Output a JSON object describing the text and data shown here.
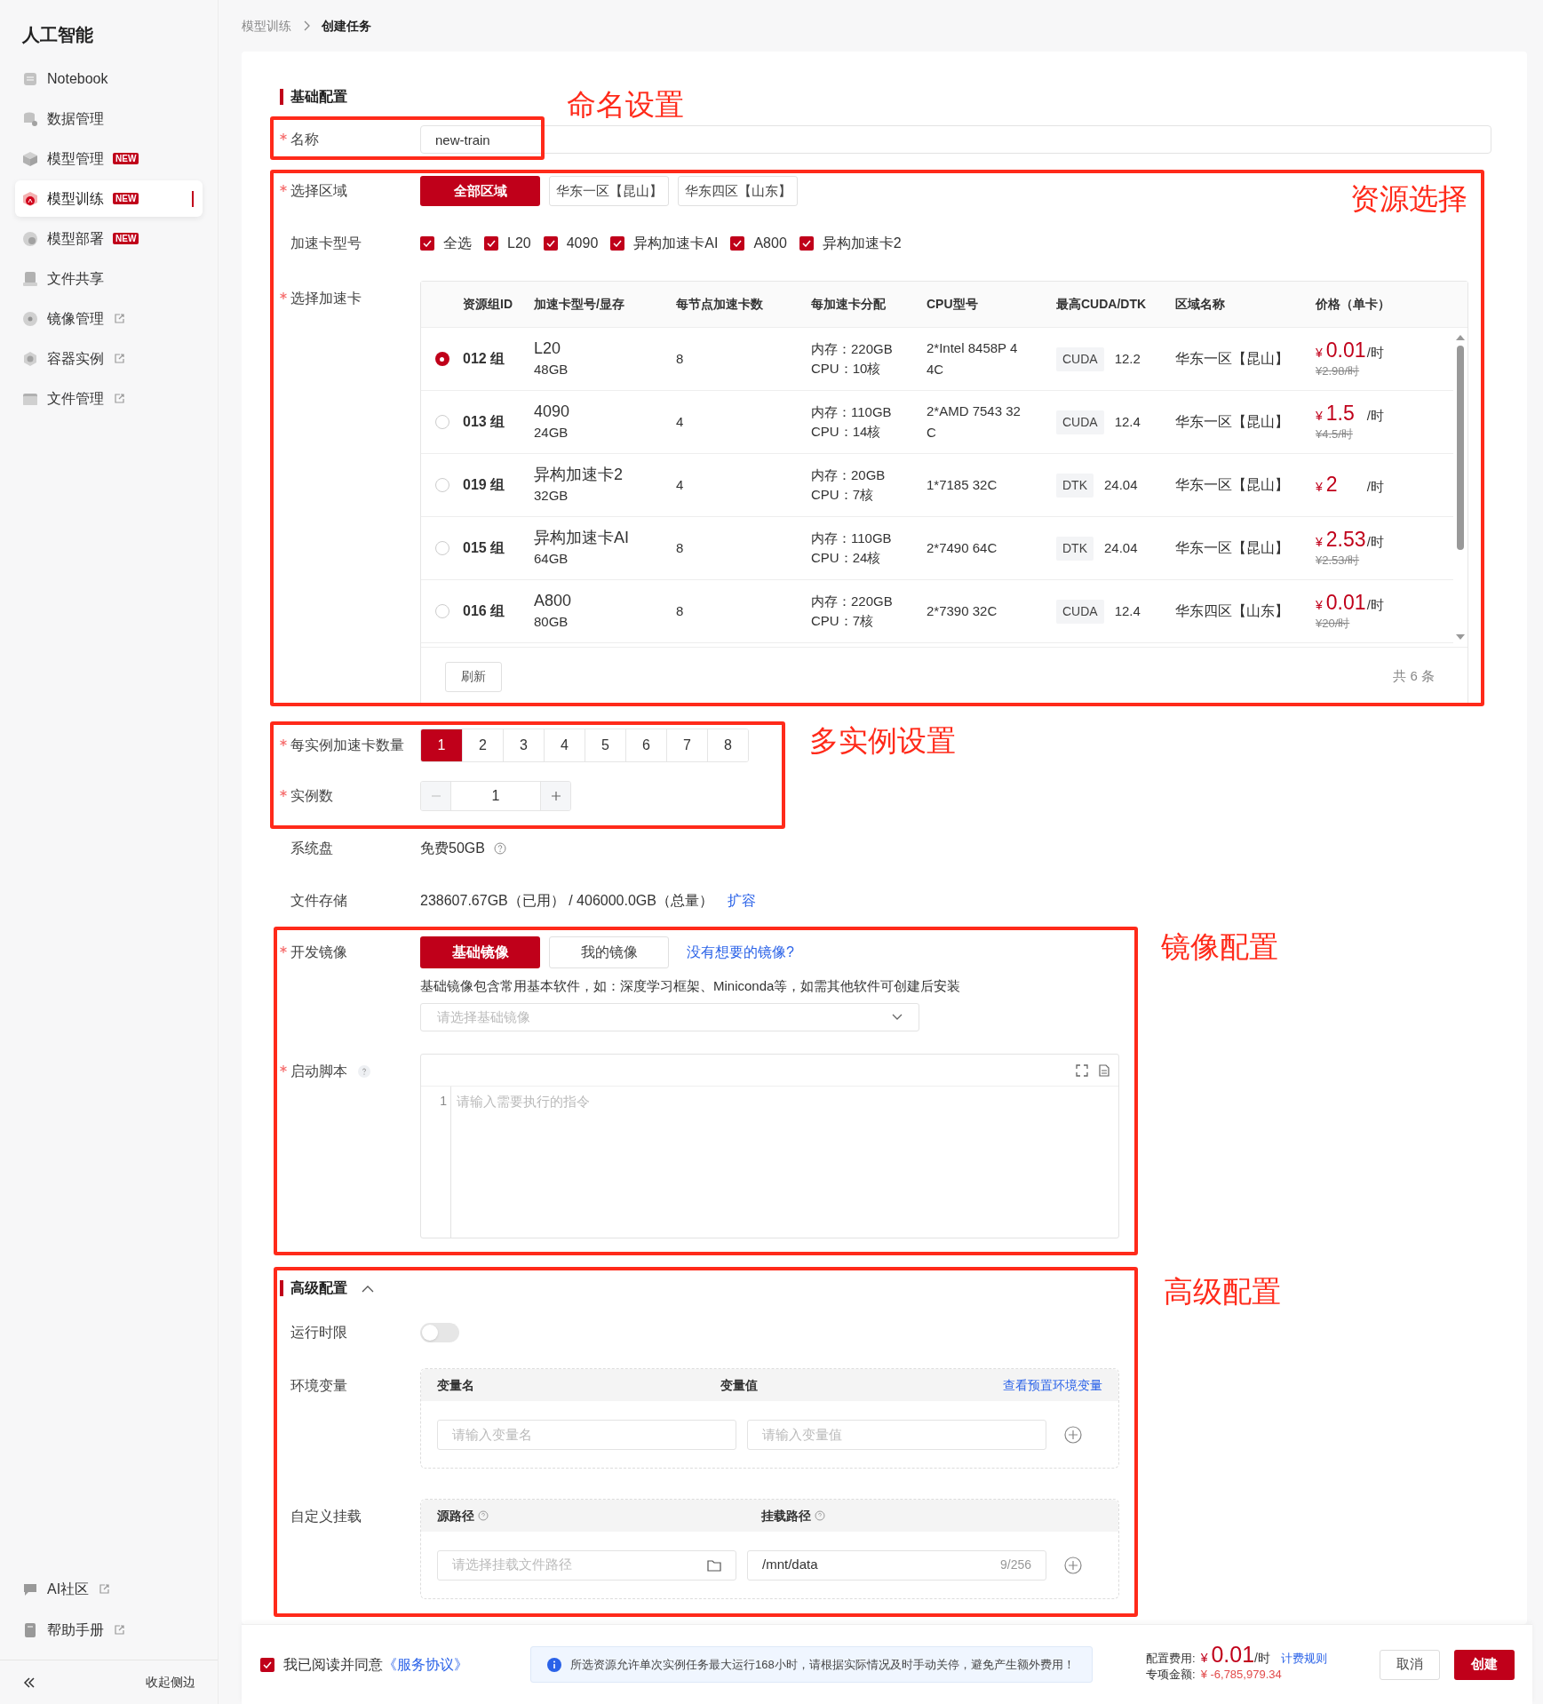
{
  "sidebar": {
    "title": "人工智能",
    "items": [
      {
        "label": "Notebook",
        "selected": false
      },
      {
        "label": "数据管理",
        "selected": false
      },
      {
        "label": "模型管理",
        "badge": "NEW",
        "selected": false
      },
      {
        "label": "模型训练",
        "badge": "NEW",
        "selected": true
      },
      {
        "label": "模型部署",
        "badge": "NEW",
        "selected": false
      },
      {
        "label": "文件共享",
        "selected": false
      },
      {
        "label": "镜像管理",
        "external": true,
        "selected": false
      },
      {
        "label": "容器实例",
        "external": true,
        "selected": false
      },
      {
        "label": "文件管理",
        "external": true,
        "selected": false
      }
    ],
    "bottom_items": [
      {
        "label": "AI社区",
        "external": true
      },
      {
        "label": "帮助手册",
        "external": true
      }
    ],
    "collapse_label": "收起侧边"
  },
  "breadcrumb": [
    "模型训练",
    "创建任务"
  ],
  "basic": {
    "heading": "基础配置",
    "name": {
      "label": "名称",
      "required": true,
      "value": "new-train"
    },
    "region": {
      "label": "选择区域",
      "required": true,
      "options": [
        {
          "label": "全部区域",
          "selected": true
        },
        {
          "label": "华东一区【昆山】",
          "selected": false
        },
        {
          "label": "华东四区【山东】",
          "selected": false
        }
      ]
    },
    "card_types": {
      "label": "加速卡型号",
      "required": false,
      "options": [
        {
          "label": "全选",
          "checked": true
        },
        {
          "label": "L20",
          "checked": true
        },
        {
          "label": "4090",
          "checked": true
        },
        {
          "label": "异构加速卡AI",
          "checked": true
        },
        {
          "label": "A800",
          "checked": true
        },
        {
          "label": "异构加速卡2",
          "checked": true
        }
      ]
    },
    "card_select": {
      "label": "选择加速卡",
      "required": true,
      "columns": [
        "资源组ID",
        "加速卡型号/显存",
        "每节点加速卡数",
        "每加速卡分配",
        "CPU型号",
        "最高CUDA/DTK",
        "区域名称",
        "价格（单卡）"
      ],
      "rows": [
        {
          "selected": true,
          "id": "012 组",
          "card": "L20",
          "memory": "48GB",
          "per_node": "8",
          "alloc_mem": "内存：220GB",
          "alloc_cpu": "CPU：10核",
          "cpu": "2*Intel 8458P 4 4C",
          "tag": "CUDA",
          "version": "12.2",
          "region": "华东一区【昆山】",
          "currency": "¥",
          "price": "0.01",
          "unit": "/时",
          "original": "¥2.98/时"
        },
        {
          "selected": false,
          "id": "013 组",
          "card": "4090",
          "memory": "24GB",
          "per_node": "4",
          "alloc_mem": "内存：110GB",
          "alloc_cpu": "CPU：14核",
          "cpu": "2*AMD 7543 32 C",
          "tag": "CUDA",
          "version": "12.4",
          "region": "华东一区【昆山】",
          "currency": "¥",
          "price": "1.5",
          "unit": "/时",
          "original": "¥4.5/时"
        },
        {
          "selected": false,
          "id": "019 组",
          "card": "异构加速卡2",
          "memory": "32GB",
          "per_node": "4",
          "alloc_mem": "内存：20GB",
          "alloc_cpu": "CPU：7核",
          "cpu": "1*7185 32C",
          "tag": "DTK",
          "version": "24.04",
          "region": "华东一区【昆山】",
          "currency": "¥",
          "price": "2",
          "unit": "/时",
          "original": null
        },
        {
          "selected": false,
          "id": "015 组",
          "card": "异构加速卡AI",
          "memory": "64GB",
          "per_node": "8",
          "alloc_mem": "内存：110GB",
          "alloc_cpu": "CPU：24核",
          "cpu": "2*7490 64C",
          "tag": "DTK",
          "version": "24.04",
          "region": "华东一区【昆山】",
          "currency": "¥",
          "price": "2.53",
          "unit": "/时",
          "original": "¥2.53/时"
        },
        {
          "selected": false,
          "id": "016 组",
          "card": "A800",
          "memory": "80GB",
          "per_node": "8",
          "alloc_mem": "内存：220GB",
          "alloc_cpu": "CPU：7核",
          "cpu": "2*7390 32C",
          "tag": "CUDA",
          "version": "12.4",
          "region": "华东四区【山东】",
          "currency": "¥",
          "price": "0.01",
          "unit": "/时",
          "original": "¥20/时"
        }
      ],
      "refresh": "刷新",
      "total": "共 6 条"
    },
    "cards_per_instance": {
      "label": "每实例加速卡数量",
      "required": true,
      "options": [
        {
          "label": "1",
          "selected": true
        },
        {
          "label": "2",
          "selected": false
        },
        {
          "label": "3",
          "selected": false
        },
        {
          "label": "4",
          "selected": false
        },
        {
          "label": "5",
          "selected": false
        },
        {
          "label": "6",
          "selected": false
        },
        {
          "label": "7",
          "selected": false
        },
        {
          "label": "8",
          "selected": false
        }
      ]
    },
    "instances": {
      "label": "实例数",
      "required": true,
      "value": "1"
    },
    "system_disk": {
      "label": "系统盘",
      "value": "免费50GB"
    },
    "file_storage": {
      "label": "文件存储",
      "value": "238607.67GB（已用） / 406000.0GB（总量）",
      "link": "扩容"
    },
    "image": {
      "label": "开发镜像",
      "required": true,
      "tabs": [
        {
          "label": "基础镜像",
          "selected": true
        },
        {
          "label": "我的镜像",
          "selected": false
        }
      ],
      "link": "没有想要的镜像?",
      "description": "基础镜像包含常用基本软件，如：深度学习框架、Miniconda等，如需其他软件可创建后安装",
      "placeholder": "请选择基础镜像"
    },
    "script": {
      "label": "启动脚本",
      "required": true,
      "line_number": "1",
      "placeholder": "请输入需要执行的指令"
    }
  },
  "advanced": {
    "heading": "高级配置",
    "expanded": true,
    "runtime_limit": {
      "label": "运行时限",
      "on": false
    },
    "env": {
      "label": "环境变量",
      "columns": [
        "变量名",
        "变量值"
      ],
      "link": "查看预置环境变量",
      "name_placeholder": "请输入变量名",
      "value_placeholder": "请输入变量值"
    },
    "mount": {
      "label": "自定义挂载",
      "columns": [
        "源路径",
        "挂载路径"
      ],
      "source_placeholder": "请选择挂载文件路径",
      "target_value": "/mnt/data",
      "counter": "9/256"
    }
  },
  "footer": {
    "agree": {
      "checked": true,
      "text": "我已阅读并同意",
      "link": "《服务协议》"
    },
    "notice": "所选资源允许单次实例任务最大运行168小时，请根据实际情况及时手动关停，避免产生额外费用！",
    "fee_label": "配置费用:",
    "fee_currency": "¥",
    "fee_amount": "0.01",
    "fee_unit": "/时",
    "fee_link": "计费规则",
    "balance_label": "专项金额:",
    "balance_value": "¥ -6,785,979.34",
    "buttons": [
      {
        "label": "取消",
        "kind": "secondary"
      },
      {
        "label": "创建",
        "kind": "primary"
      }
    ]
  },
  "annotations": [
    {
      "label": "命名设置"
    },
    {
      "label": "资源选择"
    },
    {
      "label": "多实例设置"
    },
    {
      "label": "镜像配置"
    },
    {
      "label": "高级配置"
    }
  ]
}
